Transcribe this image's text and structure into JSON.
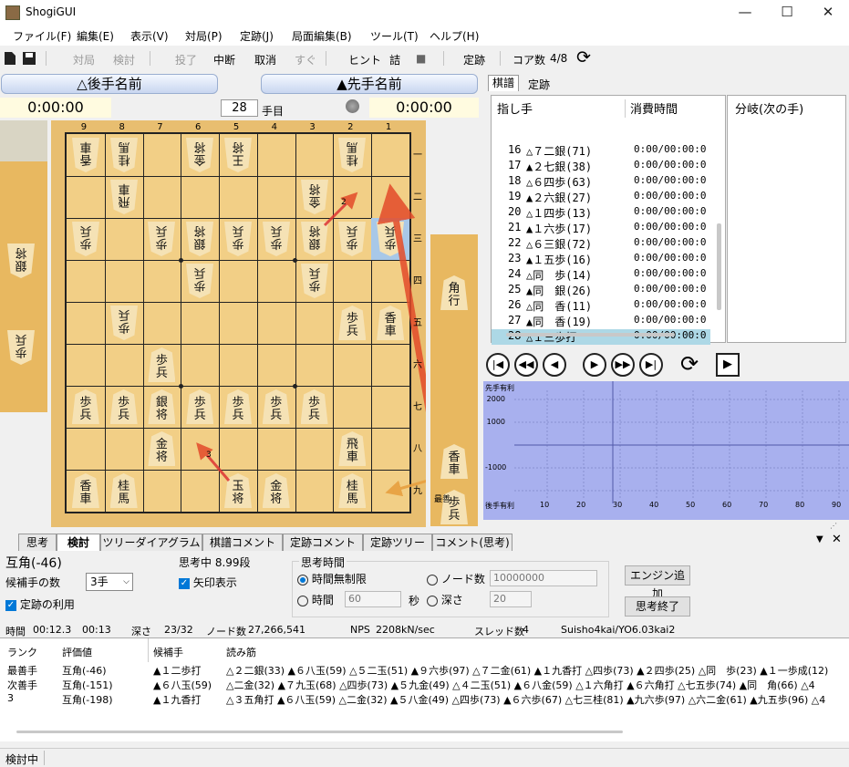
{
  "window": {
    "title": "ShogiGUI",
    "minimize": "—",
    "maximize": "☐",
    "close": "✕"
  },
  "menu": [
    "ファイル(F)",
    "編集(E)",
    "表示(V)",
    "対局(P)",
    "定跡(J)",
    "局面編集(B)",
    "ツール(T)",
    "ヘルプ(H)"
  ],
  "toolbar": {
    "taikyoku": "対局",
    "kento": "検討",
    "toryo": "投了",
    "chudan": "中断",
    "torikeshi": "取消",
    "sugu": "すぐ",
    "hint": "ヒント",
    "tsume": "詰",
    "stop": "■",
    "joseki": "定跡",
    "core_label": "コア数",
    "core_value": "4/8",
    "refresh": "⟳"
  },
  "players": {
    "gote": "△後手名前",
    "sente": "▲先手名前",
    "gote_time": "0:00:00",
    "sente_time": "0:00:00",
    "move_no": "28",
    "move_suffix": "手目"
  },
  "board": {
    "files": [
      "9",
      "8",
      "7",
      "6",
      "5",
      "4",
      "3",
      "2",
      "1"
    ],
    "ranks": [
      "一",
      "二",
      "三",
      "四",
      "五",
      "六",
      "七",
      "八",
      "九"
    ],
    "pieces": [
      {
        "f": 9,
        "r": 1,
        "p": "香車",
        "g": true
      },
      {
        "f": 8,
        "r": 1,
        "p": "桂馬",
        "g": true
      },
      {
        "f": 6,
        "r": 1,
        "p": "金将",
        "g": true
      },
      {
        "f": 5,
        "r": 1,
        "p": "王将",
        "g": true
      },
      {
        "f": 2,
        "r": 1,
        "p": "桂馬",
        "g": true
      },
      {
        "f": 8,
        "r": 2,
        "p": "飛車",
        "g": true
      },
      {
        "f": 3,
        "r": 2,
        "p": "金将",
        "g": true
      },
      {
        "f": 9,
        "r": 3,
        "p": "歩兵",
        "g": true
      },
      {
        "f": 7,
        "r": 3,
        "p": "歩兵",
        "g": true
      },
      {
        "f": 6,
        "r": 3,
        "p": "銀将",
        "g": true
      },
      {
        "f": 5,
        "r": 3,
        "p": "歩兵",
        "g": true
      },
      {
        "f": 4,
        "r": 3,
        "p": "歩兵",
        "g": true
      },
      {
        "f": 3,
        "r": 3,
        "p": "銀将",
        "g": true
      },
      {
        "f": 2,
        "r": 3,
        "p": "歩兵",
        "g": true
      },
      {
        "f": 1,
        "r": 3,
        "p": "歩兵",
        "g": true
      },
      {
        "f": 6,
        "r": 4,
        "p": "歩兵",
        "g": true
      },
      {
        "f": 3,
        "r": 4,
        "p": "歩兵",
        "g": true
      },
      {
        "f": 8,
        "r": 5,
        "p": "歩兵",
        "g": true
      },
      {
        "f": 2,
        "r": 5,
        "p": "歩兵",
        "g": false
      },
      {
        "f": 1,
        "r": 5,
        "p": "香車",
        "g": false
      },
      {
        "f": 7,
        "r": 6,
        "p": "歩兵",
        "g": false
      },
      {
        "f": 9,
        "r": 7,
        "p": "歩兵",
        "g": false
      },
      {
        "f": 8,
        "r": 7,
        "p": "歩兵",
        "g": false
      },
      {
        "f": 7,
        "r": 7,
        "p": "銀将",
        "g": false
      },
      {
        "f": 6,
        "r": 7,
        "p": "歩兵",
        "g": false
      },
      {
        "f": 5,
        "r": 7,
        "p": "歩兵",
        "g": false
      },
      {
        "f": 4,
        "r": 7,
        "p": "歩兵",
        "g": false
      },
      {
        "f": 3,
        "r": 7,
        "p": "歩兵",
        "g": false
      },
      {
        "f": 7,
        "r": 8,
        "p": "金将",
        "g": false
      },
      {
        "f": 2,
        "r": 8,
        "p": "飛車",
        "g": false
      },
      {
        "f": 9,
        "r": 9,
        "p": "香車",
        "g": false
      },
      {
        "f": 8,
        "r": 9,
        "p": "桂馬",
        "g": false
      },
      {
        "f": 5,
        "r": 9,
        "p": "玉将",
        "g": false
      },
      {
        "f": 4,
        "r": 9,
        "p": "金将",
        "g": false
      },
      {
        "f": 2,
        "r": 9,
        "p": "桂馬",
        "g": false
      }
    ],
    "highlight": {
      "f": 1,
      "r": 3
    },
    "gote_hand": [
      "銀将",
      "歩兵"
    ],
    "sente_hand": [
      "角行",
      "香車",
      "歩兵"
    ],
    "arrow_labels": [
      "2",
      "3",
      "最善"
    ]
  },
  "kifu_tabs": [
    "棋譜",
    "定跡"
  ],
  "kifu": {
    "col_move": "指し手",
    "col_time": "消費時間",
    "branch_header": "分岐(次の手)",
    "rows": [
      {
        "n": "16",
        "m": "△７二銀(71)",
        "t": "0:00/00:00:0"
      },
      {
        "n": "17",
        "m": "▲２七銀(38)",
        "t": "0:00/00:00:0"
      },
      {
        "n": "18",
        "m": "△６四歩(63)",
        "t": "0:00/00:00:0"
      },
      {
        "n": "19",
        "m": "▲２六銀(27)",
        "t": "0:00/00:00:0"
      },
      {
        "n": "20",
        "m": "△１四歩(13)",
        "t": "0:00/00:00:0"
      },
      {
        "n": "21",
        "m": "▲１六歩(17)",
        "t": "0:00/00:00:0"
      },
      {
        "n": "22",
        "m": "△６三銀(72)",
        "t": "0:00/00:00:0"
      },
      {
        "n": "23",
        "m": "▲１五歩(16)",
        "t": "0:00/00:00:0"
      },
      {
        "n": "24",
        "m": "△同　歩(14)",
        "t": "0:00/00:00:0"
      },
      {
        "n": "25",
        "m": "▲同　銀(26)",
        "t": "0:00/00:00:0"
      },
      {
        "n": "26",
        "m": "△同　香(11)",
        "t": "0:00/00:00:0"
      },
      {
        "n": "27",
        "m": "▲同　香(19)",
        "t": "0:00/00:00:0"
      },
      {
        "n": "28",
        "m": "△１三歩打",
        "t": "0:00/00:00:0"
      }
    ]
  },
  "graph": {
    "title": "先手有利",
    "bottom": "後手有利",
    "yticks": [
      "2000",
      "1000",
      "-1000",
      "2000"
    ],
    "xticks": [
      "10",
      "20",
      "30",
      "40",
      "50",
      "60",
      "70",
      "80",
      "90"
    ]
  },
  "bottom_tabs": [
    "思考",
    "検討",
    "ツリーダイアグラム",
    "棋譜コメント",
    "定跡コメント",
    "定跡ツリー",
    "コメント(思考)"
  ],
  "analysis": {
    "eval": "互角(-46)",
    "thinking": "思考中 8.99段",
    "cand_label": "候補手の数",
    "cand_value": "3手",
    "arrow_label": "矢印表示",
    "joseki_label": "定跡の利用",
    "time_group": "思考時間",
    "opt_unlimited": "時間無制限",
    "opt_time": "時間",
    "time_value": "60",
    "sec": "秒",
    "opt_nodes": "ノード数",
    "nodes_value": "10000000",
    "opt_depth": "深さ",
    "depth_value": "20",
    "add_engine": "エンジン追加",
    "stop_think": "思考終了",
    "status_time_label": "時間",
    "time1": "00:12.3",
    "time2": "00:13",
    "depth_label": "深さ",
    "depth": "23/32",
    "nodes_label": "ノード数",
    "nodes": "27,266,541",
    "nps_label": "NPS",
    "nps": "2208kN/sec",
    "threads_label": "スレッド数",
    "threads": "4",
    "engine": "Suisho4kai/YO6.03kai2"
  },
  "cands": {
    "headers": [
      "ランク",
      "評価値",
      "候補手",
      "読み筋"
    ],
    "rows": [
      {
        "rank": "最善手",
        "eval": "互角(-46)",
        "move": "▲１二歩打",
        "pv": "△２二銀(33) ▲６八玉(59) △５二玉(51) ▲９六歩(97) △７二金(61) ▲１九香打 △四歩(73) ▲２四歩(25) △同　歩(23) ▲１一歩成(12)"
      },
      {
        "rank": "次善手",
        "eval": "互角(-151)",
        "move": "▲６八玉(59)",
        "pv": "△二金(32) ▲７九玉(68) △四歩(73) ▲５九金(49) △４二玉(51) ▲６八金(59) △１六角打 ▲６六角打 △七五歩(74) ▲同　角(66) △4"
      },
      {
        "rank": "3",
        "eval": "互角(-198)",
        "move": "▲１九香打",
        "pv": "△３五角打 ▲６八玉(59) △二金(32) ▲５八金(49) △四歩(73) ▲６六歩(67) △七三桂(81) ▲九六歩(97) △六二金(61) ▲九五歩(96) △4"
      }
    ]
  },
  "status": "検討中"
}
